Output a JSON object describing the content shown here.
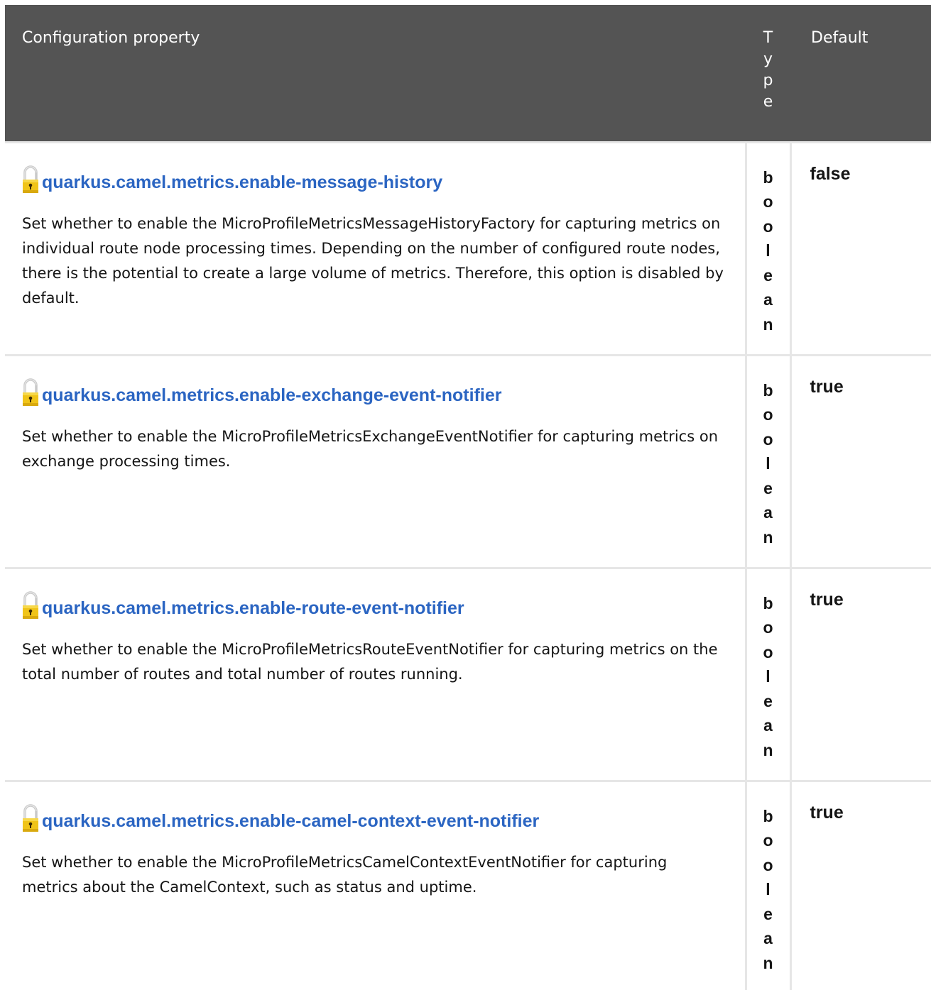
{
  "table": {
    "headers": {
      "property": "Configuration property",
      "type": "Type",
      "default": "Default"
    },
    "rows": [
      {
        "icon": "lock-icon",
        "property": "quarkus.camel.metrics.enable-message-history",
        "description": "Set whether to enable the MicroProfileMetricsMessageHistoryFactory for capturing metrics on individual route node processing times. Depending on the number of configured route nodes, there is the potential to create a large volume of metrics. Therefore, this option is disabled by default.",
        "type": "boolean",
        "default": "false"
      },
      {
        "icon": "lock-icon",
        "property": "quarkus.camel.metrics.enable-exchange-event-notifier",
        "description": "Set whether to enable the MicroProfileMetricsExchangeEventNotifier for capturing metrics on exchange processing times.",
        "type": "boolean",
        "default": "true"
      },
      {
        "icon": "lock-icon",
        "property": "quarkus.camel.metrics.enable-route-event-notifier",
        "description": "Set whether to enable the MicroProfileMetricsRouteEventNotifier for capturing metrics on the total number of routes and total number of routes running.",
        "type": "boolean",
        "default": "true"
      },
      {
        "icon": "lock-icon",
        "property": "quarkus.camel.metrics.enable-camel-context-event-notifier",
        "description": "Set whether to enable the MicroProfileMetricsCamelContextEventNotifier for capturing metrics about the CamelContext, such as status and uptime.",
        "type": "boolean",
        "default": "true"
      }
    ]
  },
  "colors": {
    "header_bg": "#545454",
    "link": "#2b65c2",
    "border": "#e6e6e6",
    "lock_body": "#f0c419"
  }
}
